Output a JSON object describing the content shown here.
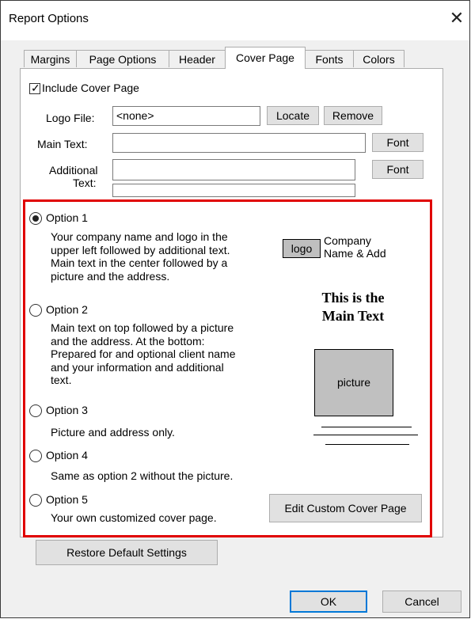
{
  "window": {
    "title": "Report Options",
    "close_glyph": "✕"
  },
  "tabs": [
    {
      "label": "Margins",
      "active": false
    },
    {
      "label": "Page Options",
      "active": false
    },
    {
      "label": "Header",
      "active": false
    },
    {
      "label": "Cover Page",
      "active": true
    },
    {
      "label": "Fonts",
      "active": false
    },
    {
      "label": "Colors",
      "active": false
    }
  ],
  "cover": {
    "include_label": "Include Cover Page",
    "include_checked": true,
    "logo_label": "Logo File:",
    "logo_value": "<none>",
    "locate_label": "Locate",
    "remove_label": "Remove",
    "main_text_label": "Main Text:",
    "main_text_value": "",
    "font_label": "Font",
    "additional_label_1": "Additional",
    "additional_label_2": "Text:",
    "additional_value_1": "",
    "additional_value_2": ""
  },
  "options": [
    {
      "label": "Option 1",
      "selected": true,
      "desc": [
        "Your company name and logo in the",
        "upper left followed by additional text.",
        "Main text in the center followed by a",
        "picture and the address."
      ]
    },
    {
      "label": "Option 2",
      "selected": false,
      "desc": [
        "Main text on top followed by a picture",
        "and the address. At the bottom:",
        "Prepared for and optional client name",
        "and your information and additional",
        "text."
      ]
    },
    {
      "label": "Option 3",
      "selected": false,
      "desc": [
        "Picture and address only."
      ]
    },
    {
      "label": "Option 4",
      "selected": false,
      "desc": [
        "Same as option 2 without the picture."
      ]
    },
    {
      "label": "Option 5",
      "selected": false,
      "desc": [
        "Your own customized cover page."
      ]
    }
  ],
  "preview": {
    "logo_text": "logo",
    "company_line_1": "Company",
    "company_line_2": "Name & Add",
    "main_text_line_1": "This is the",
    "main_text_line_2": "Main Text",
    "picture_text": "picture"
  },
  "buttons": {
    "edit_custom": "Edit Custom Cover Page",
    "restore_defaults": "Restore Default Settings",
    "ok": "OK",
    "cancel": "Cancel"
  },
  "colors": {
    "highlight_border": "#e00000",
    "default_button_border": "#0078d7"
  }
}
